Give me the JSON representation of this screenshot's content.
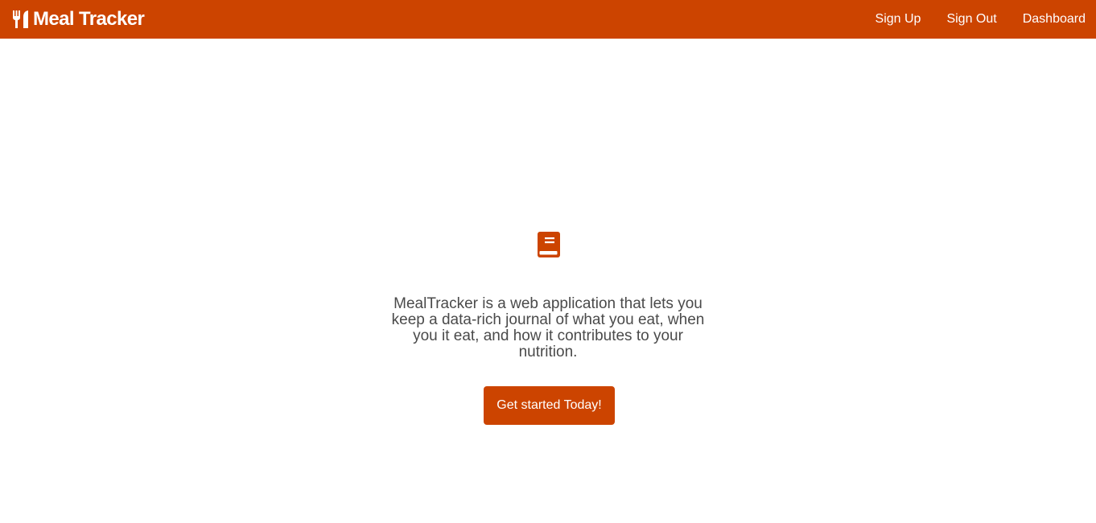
{
  "navbar": {
    "brand": {
      "icon": "utensils-icon",
      "title": "Meal Tracker"
    },
    "links": [
      {
        "label": "Sign Up"
      },
      {
        "label": "Sign Out"
      },
      {
        "label": "Dashboard"
      }
    ]
  },
  "hero": {
    "icon": "book-icon",
    "description": "MealTracker is a web application that lets you keep a data-rich journal of what you eat, when you it eat, and how it contributes to your nutrition.",
    "cta_label": "Get started Today!"
  },
  "colors": {
    "brand": "#cc4400",
    "text": "#4a4a4a",
    "background": "#ffffff"
  }
}
